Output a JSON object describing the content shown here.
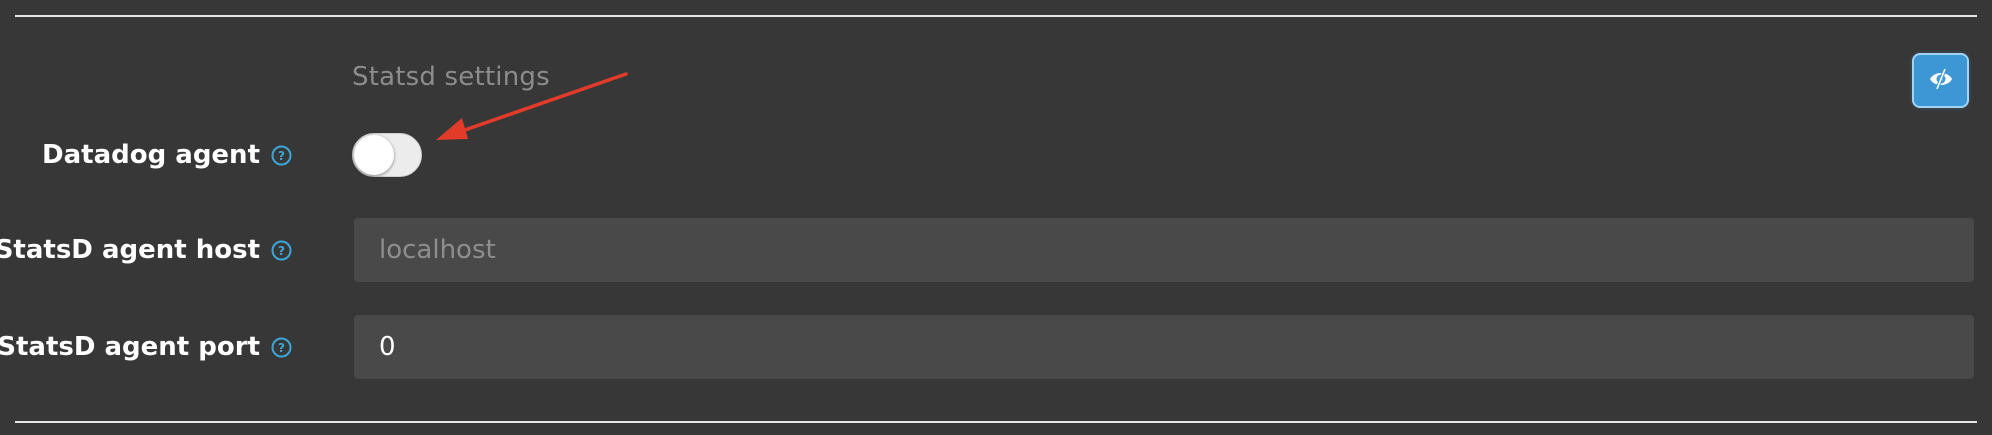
{
  "section": {
    "title": "Statsd settings"
  },
  "toolbar": {
    "toggle_view_icon": "eye-slash-icon",
    "accent": "#3d97d5"
  },
  "fields": [
    {
      "label": "Datadog agent",
      "type": "toggle",
      "checked": false,
      "help_icon": "question-circle-icon"
    },
    {
      "label": "StatsD agent host",
      "type": "text",
      "value": "",
      "placeholder": "localhost",
      "help_icon": "question-circle-icon"
    },
    {
      "label": "StatsD agent port",
      "type": "number",
      "value": "0",
      "help_icon": "question-circle-icon"
    }
  ],
  "annotation": {
    "shape": "arrow",
    "color": "#e23b2a"
  },
  "colors": {
    "background": "#373737",
    "input_bg": "#494949",
    "help": "#3ba7d9"
  }
}
